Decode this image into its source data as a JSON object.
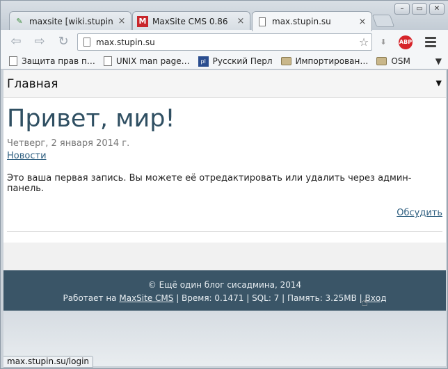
{
  "browser": {
    "tabs": [
      {
        "label": "maxsite [wiki.stupin.su",
        "favicon": "wiki-icon",
        "close": "×"
      },
      {
        "label": "MaxSite CMS 0.86",
        "favicon": "maxsite-icon",
        "close": "×"
      },
      {
        "label": "max.stupin.su",
        "favicon": "page-icon",
        "close": "×"
      }
    ],
    "window_buttons": {
      "minimize": "–",
      "maximize": "▭",
      "close": "✕"
    },
    "url": "max.stupin.su",
    "bookmarks": [
      {
        "label": "Защита прав п…",
        "icon": "page-icon"
      },
      {
        "label": "UNIX man page…",
        "icon": "page-icon"
      },
      {
        "label": "Русский Перл",
        "icon": "perl-icon"
      },
      {
        "label": "Импортирован…",
        "icon": "folder-icon"
      },
      {
        "label": "OSM",
        "icon": "folder-icon"
      }
    ],
    "abp_label": "ABP",
    "status_url": "max.stupin.su/login"
  },
  "page": {
    "nav_home": "Главная",
    "nav_arrow": "▼",
    "post": {
      "title": "Привет, мир!",
      "date": "Четверг, 2 января 2014 г.",
      "category": "Новости",
      "text": "Это ваша первая запись. Вы можете её отредактировать или удалить через админ-панель.",
      "discuss": "Обсудить"
    },
    "footer": {
      "copyright": "© Ещё один блог сисадмина, 2014",
      "powered_prefix": "Работает на ",
      "powered_link": "MaxSite CMS",
      "stats": " | Время: 0.1471 | SQL: 7 | Память: 3.25MB | ",
      "login": "Вход"
    }
  },
  "colors": {
    "title": "#2f4f62",
    "footer_bg": "#3a5567",
    "link": "#2f5f80"
  }
}
